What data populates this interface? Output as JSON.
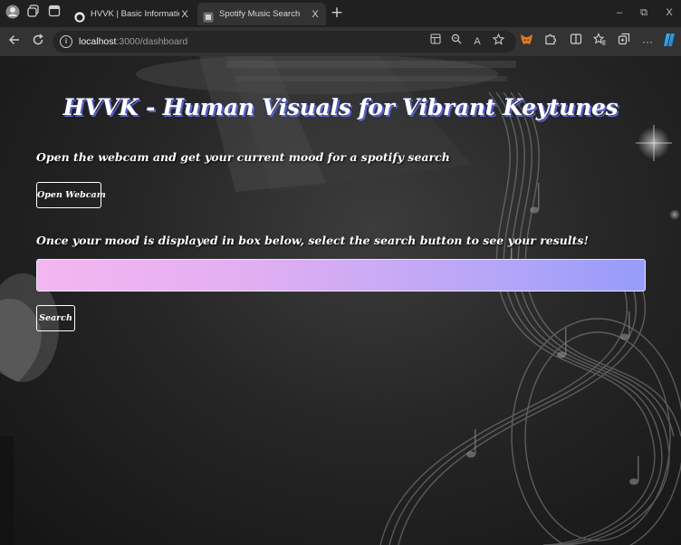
{
  "browser": {
    "tabs": [
      {
        "title": "HVVK | Basic Information",
        "active": false,
        "close": "X"
      },
      {
        "title": "Spotify Music Search",
        "active": true,
        "close": "X"
      }
    ],
    "new_tab_label": "+",
    "window_controls": {
      "minimize": "–",
      "restore": "⧉",
      "close": "X"
    },
    "url": {
      "host": "localhost",
      "path": ":3000/dashboard"
    },
    "address_actions": {
      "read_aloud": "A"
    },
    "toolbar": {
      "more": "···"
    }
  },
  "page": {
    "title": "HVVK - Human Visuals for Vibrant Keytunes",
    "webcam_prompt": "Open the webcam and get your current mood for a spotify search",
    "open_webcam_label": "Open Webcam",
    "mood_instruction": "Once your mood is displayed in box below, select the search button to see your results!",
    "mood_value": "",
    "search_label": "Search"
  },
  "colors": {
    "title_shadow": "#5a63c9",
    "mood_gradient_start": "#f4b6f0",
    "mood_gradient_end": "#969bfa",
    "active_tab": "#333333"
  },
  "icons": {
    "profile": "profile-avatar-icon",
    "workspaces": "workspaces-icon",
    "tab_actions": "tab-actions-icon",
    "back": "back-arrow-icon",
    "refresh": "refresh-icon",
    "info": "site-info-icon",
    "app_available": "app-available-icon",
    "zoom": "zoom-icon",
    "favorite": "favorite-star-icon",
    "extension": "metamask-fox-icon",
    "extensions": "extensions-puzzle-icon",
    "split_screen": "split-screen-icon",
    "favorites": "favorites-icon",
    "collections": "collections-icon",
    "copilot": "copilot-icon"
  }
}
